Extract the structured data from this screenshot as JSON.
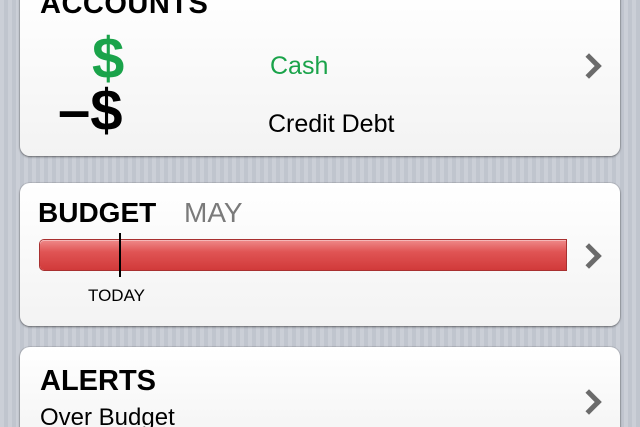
{
  "colors": {
    "positive": "#1aa34a",
    "budget_bar": "#d94646",
    "muted": "#7a7a7a"
  },
  "accounts": {
    "title": "ACCOUNTS",
    "rows": [
      {
        "symbol": "$",
        "label": "Cash"
      },
      {
        "symbol": "–$",
        "label": "Credit Debt"
      }
    ]
  },
  "budget": {
    "title": "BUDGET",
    "month": "MAY",
    "today_label": "TODAY",
    "spent_fraction": 1.0,
    "today_fraction": 0.15
  },
  "alerts": {
    "title": "ALERTS",
    "subtitle": "Over Budget"
  }
}
